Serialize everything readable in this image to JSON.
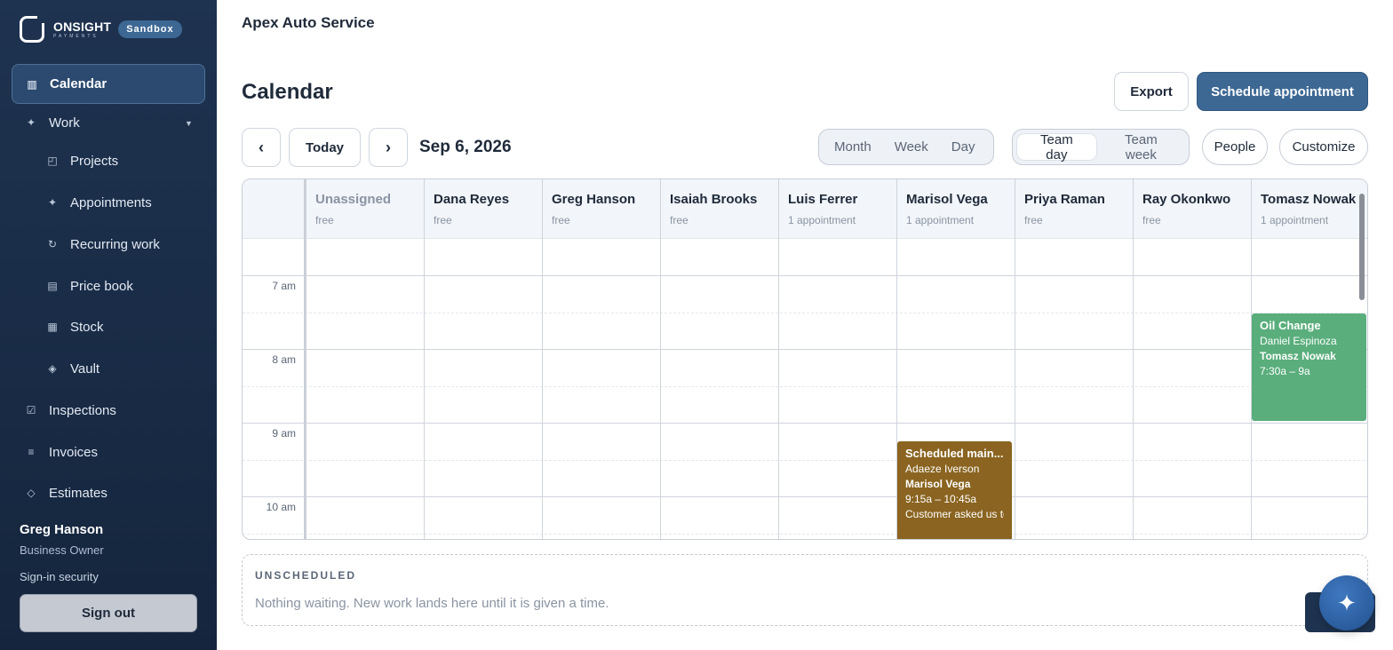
{
  "brand": {
    "name": "ONSIGHT",
    "sub": "PAYMENTS",
    "badge": "Sandbox"
  },
  "sidebar": {
    "items": [
      {
        "label": "Calendar",
        "icon": "calendar-icon"
      },
      {
        "label": "Work",
        "icon": "sparkle-icon"
      },
      {
        "label": "Projects",
        "icon": "projects-icon"
      },
      {
        "label": "Appointments",
        "icon": "sparkle-icon"
      },
      {
        "label": "Recurring work",
        "icon": "refresh-icon"
      },
      {
        "label": "Price book",
        "icon": "book-icon"
      },
      {
        "label": "Stock",
        "icon": "grid-icon"
      },
      {
        "label": "Vault",
        "icon": "diamond-icon"
      },
      {
        "label": "Inspections",
        "icon": "checkbox-icon"
      },
      {
        "label": "Invoices",
        "icon": "list-icon"
      },
      {
        "label": "Estimates",
        "icon": "diamond-outline-icon"
      }
    ],
    "user_name": "Greg Hanson",
    "user_role": "Business Owner",
    "signin_security": "Sign-in security",
    "signout_label": "Sign out"
  },
  "header": {
    "org_name": "Apex Auto Service",
    "page_title": "Calendar"
  },
  "toolbar": {
    "export_label": "Export",
    "schedule_label": "Schedule appointment",
    "prev_label": "‹",
    "today_label": "Today",
    "next_label": "›",
    "date": "Sep 6, 2026",
    "views": [
      "Month",
      "Week",
      "Day"
    ],
    "team_views": [
      "Team day",
      "Team week"
    ],
    "team_view_selected": "Team day",
    "people_label": "People",
    "customize_label": "Customize"
  },
  "calendar": {
    "columns": [
      {
        "name": "Unassigned",
        "status": "free"
      },
      {
        "name": "Dana Reyes",
        "status": "free"
      },
      {
        "name": "Greg Hanson",
        "status": "free"
      },
      {
        "name": "Isaiah Brooks",
        "status": "free"
      },
      {
        "name": "Luis Ferrer",
        "status": "1 appointment"
      },
      {
        "name": "Marisol Vega",
        "status": "1 appointment"
      },
      {
        "name": "Priya Raman",
        "status": "free"
      },
      {
        "name": "Ray Okonkwo",
        "status": "free"
      },
      {
        "name": "Tomasz Nowak",
        "status": "1 appointment"
      }
    ],
    "time_labels": [
      "7 am",
      "8 am",
      "9 am",
      "10 am"
    ],
    "events": [
      {
        "title": "Oil Change",
        "customer": "Daniel Espinoza",
        "assignee": "Tomasz Nowak",
        "time": "7:30a – 9a",
        "color": "#5aae7c"
      },
      {
        "title": "Scheduled main...",
        "customer": "Adaeze Iverson",
        "assignee": "Marisol Vega",
        "time": "9:15a – 10:45a",
        "note": "Customer asked us to",
        "color": "#8a6420"
      }
    ]
  },
  "unscheduled": {
    "title": "UNSCHEDULED",
    "text": "Nothing waiting. New work lands here until it is given a time."
  },
  "colors": {
    "sidebar_bg": "#1e3350",
    "primary": "#3d6894",
    "event_green": "#5aae7c",
    "event_brown": "#8a6420"
  },
  "assistant_icon": "sparkle-icon"
}
